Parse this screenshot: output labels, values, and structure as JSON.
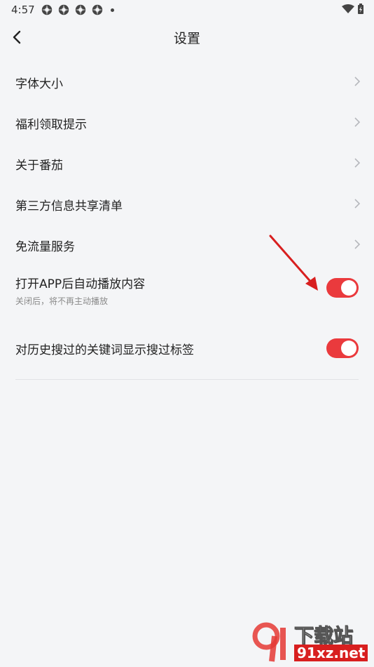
{
  "status": {
    "time": "4:57"
  },
  "header": {
    "title": "设置"
  },
  "settings": {
    "items": [
      {
        "label": "字体大小"
      },
      {
        "label": "福利领取提示"
      },
      {
        "label": "关于番茄"
      },
      {
        "label": "第三方信息共享清单"
      },
      {
        "label": "免流量服务"
      }
    ],
    "toggles": [
      {
        "label": "打开APP后自动播放内容",
        "subtitle": "关闭后，将不再主动播放",
        "on": true
      },
      {
        "label": "对历史搜过的关键词显示搜过标签",
        "on": true
      }
    ]
  },
  "colors": {
    "accent": "#ea3a3d",
    "background": "#f4f5f7"
  },
  "watermark": {
    "brand": "下载站",
    "url": "91xz.net"
  }
}
